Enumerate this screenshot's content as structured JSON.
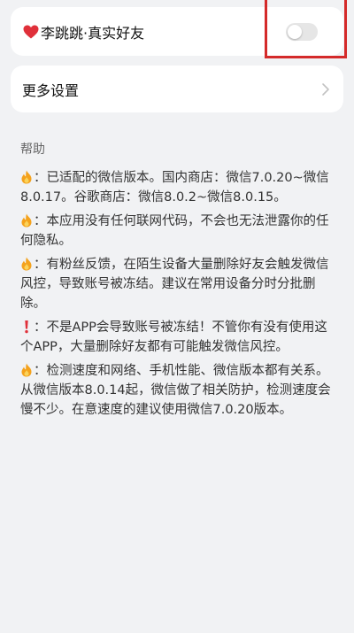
{
  "toggle_card": {
    "label": "李跳跳·真实好友",
    "enabled": false,
    "icon": "heart-icon"
  },
  "more_settings": {
    "label": "更多设置",
    "icon": "chevron-right-icon"
  },
  "help": {
    "title": "帮助",
    "items": [
      {
        "icon": "fire-icon",
        "text": "：已适配的微信版本。国内商店：微信7.0.20~微信8.0.17。谷歌商店：微信8.0.2~微信8.0.15。"
      },
      {
        "icon": "fire-icon",
        "text": "：本应用没有任何联网代码，不会也无法泄露你的任何隐私。"
      },
      {
        "icon": "fire-icon",
        "text": "：有粉丝反馈，在陌生设备大量删除好友会触发微信风控，导致账号被冻结。建议在常用设备分时分批删除。"
      },
      {
        "icon": "exclamation-icon",
        "text": "：不是APP会导致账号被冻结！不管你有没有使用这个APP，大量删除好友都有可能触发微信风控。"
      },
      {
        "icon": "fire-icon",
        "text": "：检测速度和网络、手机性能、微信版本都有关系。从微信版本8.0.14起，微信做了相关防护，检测速度会慢不少。在意速度的建议使用微信7.0.20版本。"
      }
    ]
  },
  "colors": {
    "background": "#f1f2f4",
    "highlight": "#d42a2a",
    "fire": "#f4a21c",
    "heart": "#e0303a"
  }
}
